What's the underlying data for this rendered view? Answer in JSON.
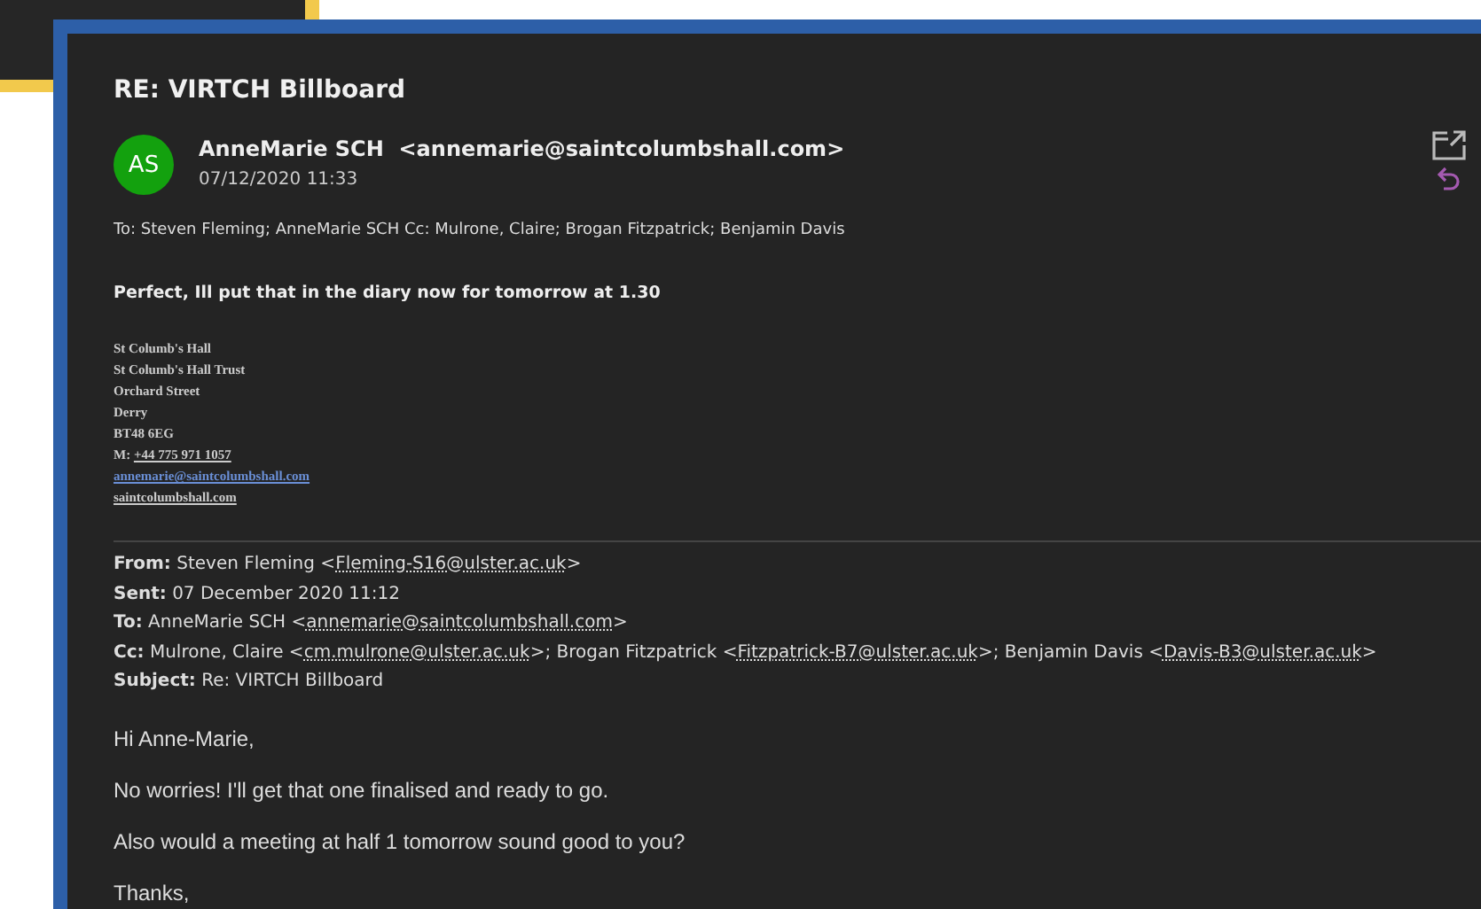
{
  "email": {
    "subject": "RE: VIRTCH Billboard",
    "avatar_initials": "AS",
    "sender": "AnneMarie SCH  <annemarie@saintcolumbshall.com>",
    "date": "07/12/2020 11:33",
    "recipients": "To: Steven Fleming; AnneMarie SCH Cc: Mulrone, Claire; Brogan Fitzpatrick; Benjamin Davis",
    "reply_text": "Perfect, Ill put that in the diary now for tomorrow at 1.30",
    "signature": [
      {
        "kind": "text",
        "text": "St Columb's Hall"
      },
      {
        "kind": "text",
        "text": "St Columb's Hall Trust"
      },
      {
        "kind": "text",
        "text": "Orchard Street"
      },
      {
        "kind": "text",
        "text": "Derry"
      },
      {
        "kind": "text",
        "text": "BT48 6EG"
      },
      {
        "kind": "phone",
        "text": "M: ",
        "link": "+44 775 971 1057"
      },
      {
        "kind": "email",
        "link": "annemarie@saintcolumbshall.com"
      },
      {
        "kind": "web",
        "link": "saintcolumbshall.com"
      }
    ],
    "quoted_header": [
      {
        "label": "From:",
        "parts": [
          {
            "text": " Steven Fleming <"
          },
          {
            "link": "Fleming-S16@ulster.ac.uk"
          },
          {
            "text": ">"
          }
        ]
      },
      {
        "label": "Sent:",
        "parts": [
          {
            "text": " 07 December 2020 11:12"
          }
        ]
      },
      {
        "label": "To:",
        "parts": [
          {
            "text": " AnneMarie SCH <"
          },
          {
            "link": "annemarie@saintcolumbshall.com"
          },
          {
            "text": ">"
          }
        ]
      },
      {
        "label": "Cc:",
        "parts": [
          {
            "text": " Mulrone, Claire <"
          },
          {
            "link": "cm.mulrone@ulster.ac.uk"
          },
          {
            "text": ">; Brogan Fitzpatrick <"
          },
          {
            "link": "Fitzpatrick-B7@ulster.ac.uk"
          },
          {
            "text": ">; Benjamin Davis <"
          },
          {
            "link": "Davis-B3@ulster.ac.uk"
          },
          {
            "text": ">"
          }
        ]
      },
      {
        "label": "Subject:",
        "parts": [
          {
            "text": " Re: VIRTCH Billboard"
          }
        ]
      }
    ],
    "quoted_body": [
      "Hi Anne-Marie,",
      "No worries! I'll get that one finalised and ready to go.",
      "Also would a meeting at half 1 tomorrow sound good to you?",
      "Thanks,"
    ]
  }
}
